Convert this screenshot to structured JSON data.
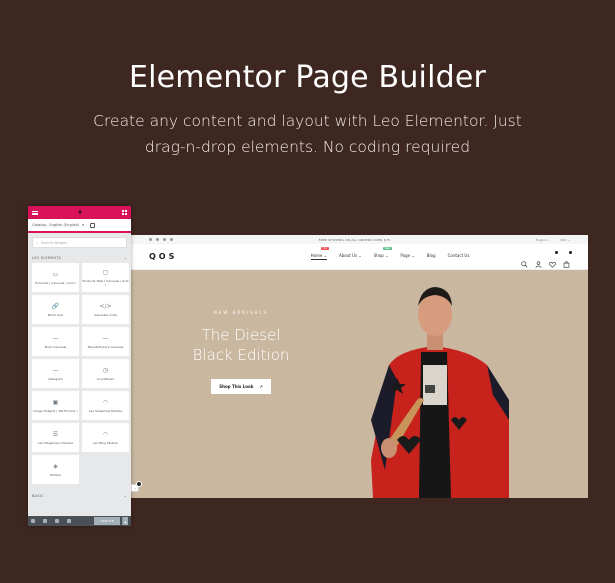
{
  "hero": {
    "title": "Elementor Page Builder",
    "subtitle": "Create any content and layout with Leo Elementor. Just drag-n-drop elements. No coding required"
  },
  "site": {
    "topbar": {
      "promo": "FREE SHIPPING ON ALL ORDERS OVER $75",
      "language": "English ⌄",
      "currency": "USD ⌄"
    },
    "logo": "QOS",
    "menu": [
      {
        "label": "Home ⌄",
        "badge": "Hot",
        "active": true
      },
      {
        "label": "About Us ⌄"
      },
      {
        "label": "Shop ⌄",
        "badge": "New"
      },
      {
        "label": "Page ⌄"
      },
      {
        "label": "Blog"
      },
      {
        "label": "Contact Us"
      }
    ],
    "header_icons": [
      "search-icon",
      "user-icon",
      "heart-icon",
      "cart-icon"
    ],
    "banner": {
      "eyebrow": "NEW ARRIVALS",
      "headline_line1": "The Diesel",
      "headline_line2": "Black Edition",
      "button_label": "Shop This Look",
      "button_icon": "↗"
    }
  },
  "panel": {
    "language_select": "Catalog - English (English)",
    "search_placeholder": "Search Widget...",
    "category_leo": "LEO ELEMENTS",
    "category_basic": "BASIC",
    "widgets": [
      {
        "label": "Products ( Carousel / Grid )",
        "icon": "▭"
      },
      {
        "label": "Products Tabs ( Carousel / Grid )",
        "icon": "▢"
      },
      {
        "label": "Block Link",
        "icon": "🔗"
      },
      {
        "label": "Generate Code",
        "icon": "</>"
      },
      {
        "label": "Brick Carousel",
        "icon": "—"
      },
      {
        "label": "Manufacturers Carousel",
        "icon": "—"
      },
      {
        "label": "Instagram",
        "icon": "—"
      },
      {
        "label": "CountDown",
        "icon": "◷"
      },
      {
        "label": "Image Hotspot ( Tell Product )",
        "icon": "▣"
      },
      {
        "label": "Leo Slideshow Module",
        "icon": "◠"
      },
      {
        "label": "Leo Megamenu Module",
        "icon": "☰"
      },
      {
        "label": "Leo Blog Module",
        "icon": "◠"
      },
      {
        "label": "Module",
        "icon": "◈"
      }
    ],
    "footer": {
      "update_label": "UPDATE",
      "update_caret": "▴"
    }
  },
  "colors": {
    "background": "#3e2720",
    "elementor_pink": "#d8135a",
    "banner_beige": "#c9b7a0"
  }
}
